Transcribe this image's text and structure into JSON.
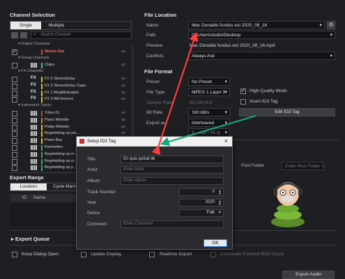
{
  "left": {
    "title": "Channel Selection",
    "tabs": [
      "Single",
      "Multiple"
    ],
    "search_placeholder": "Search Channel",
    "rows": [
      {
        "kind": "group",
        "label": "▾ Output Channels"
      },
      {
        "kind": "ch",
        "label": "Stereo Out",
        "checked": true,
        "icon": "",
        "color": "#d94040",
        "red": true
      },
      {
        "kind": "group",
        "label": "▾ Group Channels"
      },
      {
        "kind": "ch",
        "label": "Claps",
        "checked": false,
        "icon": "𝄚",
        "color": "#2fc4c4",
        "red": false
      },
      {
        "kind": "group",
        "label": "▾ FX Channels"
      },
      {
        "kind": "ch",
        "label": "FX 2-StereoDelay",
        "checked": false,
        "icon": "FX",
        "color": "#e0c020",
        "red": false
      },
      {
        "kind": "ch",
        "label": "FX 2-StereoDelay Claps",
        "checked": false,
        "icon": "FX",
        "color": "#e0c020",
        "red": false
      },
      {
        "kind": "ch",
        "label": "FX 1-RingModulator",
        "checked": false,
        "icon": "FX",
        "color": "#e0c020",
        "red": false
      },
      {
        "kind": "ch",
        "label": "FX 3-REVerence",
        "checked": false,
        "icon": "FX",
        "color": "#e0c020",
        "red": false
      },
      {
        "kind": "group",
        "label": "▾ Instrument Tracks"
      },
      {
        "kind": "ch",
        "label": "Triton 01",
        "checked": false,
        "icon": "keys",
        "color": "#c04040",
        "red": false
      },
      {
        "kind": "ch",
        "label": "Piano Melodie",
        "checked": false,
        "icon": "keys",
        "color": "#e08020",
        "red": false
      },
      {
        "kind": "ch",
        "label": "Flutije Melodie",
        "checked": false,
        "icon": "keys",
        "color": "#e0c020",
        "red": false
      },
      {
        "kind": "ch",
        "label": "Begeleiding op pia...",
        "checked": false,
        "icon": "keys",
        "color": "#e0c020",
        "red": false
      },
      {
        "kind": "ch",
        "label": "Piano Bas",
        "checked": false,
        "icon": "keys",
        "color": "#e0c020",
        "red": false
      },
      {
        "kind": "ch",
        "label": "Klarinetten",
        "checked": false,
        "icon": "keys",
        "color": "#30b060",
        "red": false
      },
      {
        "kind": "ch",
        "label": "Begeleiding op m...",
        "checked": false,
        "icon": "keys",
        "color": "#30b060",
        "red": false
      },
      {
        "kind": "ch",
        "label": "Begeleiding op m...",
        "checked": false,
        "icon": "keys",
        "color": "#30b060",
        "red": false
      },
      {
        "kind": "ch",
        "label": "Begeleiding op p...",
        "checked": false,
        "icon": "keys",
        "color": "#30b060",
        "red": false
      }
    ]
  },
  "file_location": {
    "title": "File Location",
    "name_label": "Name",
    "name_value": "Mac Donaldo fundus est 2020_08_16",
    "path_label": "Path",
    "path_value": "C:\\Users\\studio\\Desktop",
    "preview_label": "Preview",
    "preview_value": "Mac Donaldo fundus est 2020_08_16.mp3",
    "conflicts_label": "Conflicts",
    "conflicts_value": "Always Ask"
  },
  "file_format": {
    "title": "File Format",
    "preset_label": "Preset",
    "preset_value": "No Preset",
    "type_label": "File Type",
    "type_value": "MPEG 1 Layer 3",
    "sample_label": "Sample Rate",
    "sample_value": "44.100 kHz",
    "bitrate_label": "Bit Rate",
    "bitrate_value": "160 kB/s",
    "export_label": "Export as",
    "export_value": "Interleaved",
    "extra_value": "3 ... dio - 01 (L",
    "hq_label": "High-Quality Mode",
    "id3_label": "Insert ID3 Tag",
    "edit_id3": "Edit ID3 Tag",
    "pool_label": "Pool Folder",
    "pool_placeholder": "Enter Pool Folder N..."
  },
  "export_range": {
    "title": "Export Range",
    "tabs": [
      "Locators",
      "Cycle Markers"
    ],
    "cols": [
      "ID",
      "Name"
    ]
  },
  "export_queue": {
    "title": "Export Queue"
  },
  "bottom": {
    "keep": "Keep Dialog Open",
    "update": "Update Display",
    "realtime": "Realtime Export",
    "deactivate": "Deactivate External MIDI Inputs",
    "export_btn": "Export Audio"
  },
  "dialog": {
    "title": "Setup ID3 Tag",
    "title_label": "Title",
    "title_value": "En quis pulsat ibi",
    "artist_label": "Artist",
    "artist_ph": "Enter Artist",
    "album_label": "Album",
    "album_ph": "Enter Album",
    "track_label": "Track Number",
    "track_value": "0",
    "year_label": "Year",
    "year_value": "2020",
    "genre_label": "Genre",
    "genre_value": "Folk",
    "comment_label": "Comment",
    "comment_ph": "Enter Comment",
    "ok": "OK"
  },
  "colors": {
    "arrow_red": "#ff3b3b",
    "arrow_green": "#17a877"
  }
}
